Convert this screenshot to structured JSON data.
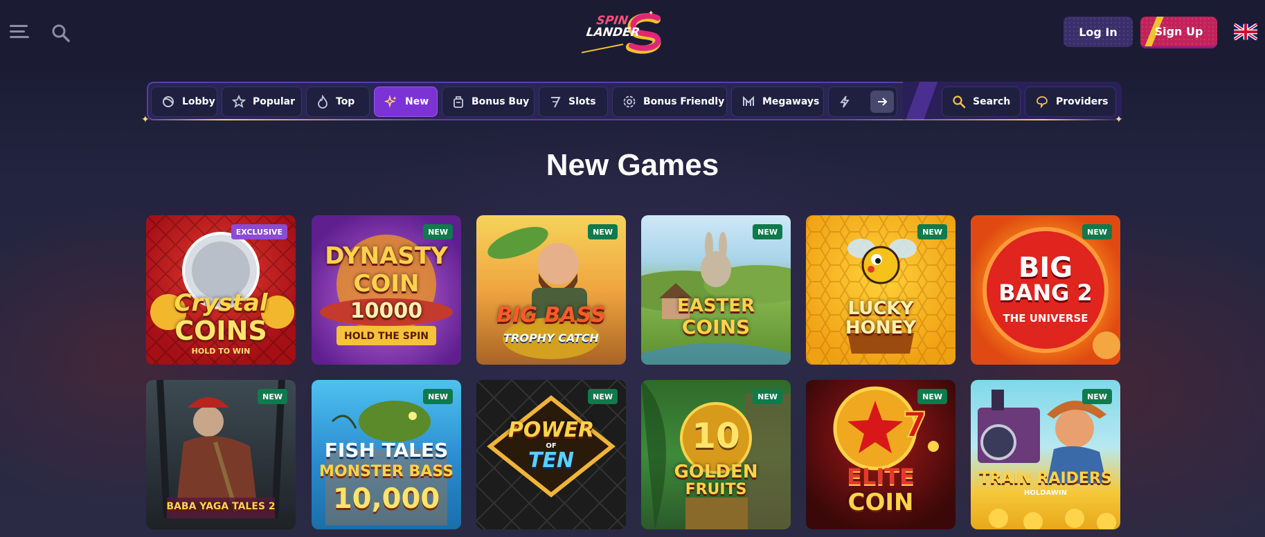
{
  "header": {
    "logo": {
      "line1": "SPIN",
      "line2": "LANDER"
    },
    "login_label": "Log In",
    "signup_label": "Sign Up"
  },
  "nav": {
    "categories": [
      {
        "label": "Lobby",
        "icon": "lobby-icon"
      },
      {
        "label": "Popular",
        "icon": "star-icon"
      },
      {
        "label": "Top",
        "icon": "flame-icon"
      },
      {
        "label": "New",
        "icon": "sparkle-icon",
        "active": true
      },
      {
        "label": "Bonus Buy",
        "icon": "bag-icon"
      },
      {
        "label": "Slots",
        "icon": "seven-icon"
      },
      {
        "label": "Bonus Friendly",
        "icon": "gear-badge-icon"
      },
      {
        "label": "Megaways",
        "icon": "megaways-icon"
      },
      {
        "label": "",
        "icon": "lightning-icon"
      }
    ],
    "search_label": "Search",
    "providers_label": "Providers"
  },
  "main": {
    "title": "New Games",
    "games": [
      {
        "title_lines": [
          "Crystal",
          "COINS"
        ],
        "sub": "HOLD TO WIN",
        "badge": "EXCLUSIVE"
      },
      {
        "title_lines": [
          "DYNASTY",
          "COIN",
          "10000"
        ],
        "sub": "HOLD THE SPIN",
        "badge": "NEW"
      },
      {
        "title_lines": [
          "BIG BASS"
        ],
        "sub": "TROPHY CATCH",
        "badge": "NEW"
      },
      {
        "title_lines": [
          "EASTER",
          "COINS"
        ],
        "sub": "",
        "badge": "NEW"
      },
      {
        "title_lines": [
          "LUCKY",
          "HONEY"
        ],
        "sub": "",
        "badge": "NEW"
      },
      {
        "title_lines": [
          "BIG",
          "BANG 2"
        ],
        "sub": "THE UNIVERSE",
        "badge": "NEW"
      },
      {
        "title_lines": [
          "BABA YAGA TALES 2"
        ],
        "sub": "",
        "badge": "NEW"
      },
      {
        "title_lines": [
          "FISH TALES",
          "MONSTER BASS",
          "10,000"
        ],
        "sub": "",
        "badge": "NEW"
      },
      {
        "title_lines": [
          "POWER",
          "TEN"
        ],
        "sub": "OF",
        "badge": "NEW"
      },
      {
        "title_lines": [
          "10",
          "GOLDEN",
          "FRUITS"
        ],
        "sub": "",
        "badge": "NEW"
      },
      {
        "title_lines": [
          "ELITE",
          "COIN"
        ],
        "sub": "",
        "badge": "NEW"
      },
      {
        "title_lines": [
          "TRAIN RAIDERS"
        ],
        "sub": "HOLDAWIN",
        "badge": "NEW"
      }
    ]
  },
  "colors": {
    "background": "#1b1c33",
    "nav_active": "#7b33d6",
    "new_badge": "#0f7a4c",
    "exclusive_badge": "#8b4bd6",
    "signup": "#c2225a",
    "accent_gold": "#f1c232"
  }
}
